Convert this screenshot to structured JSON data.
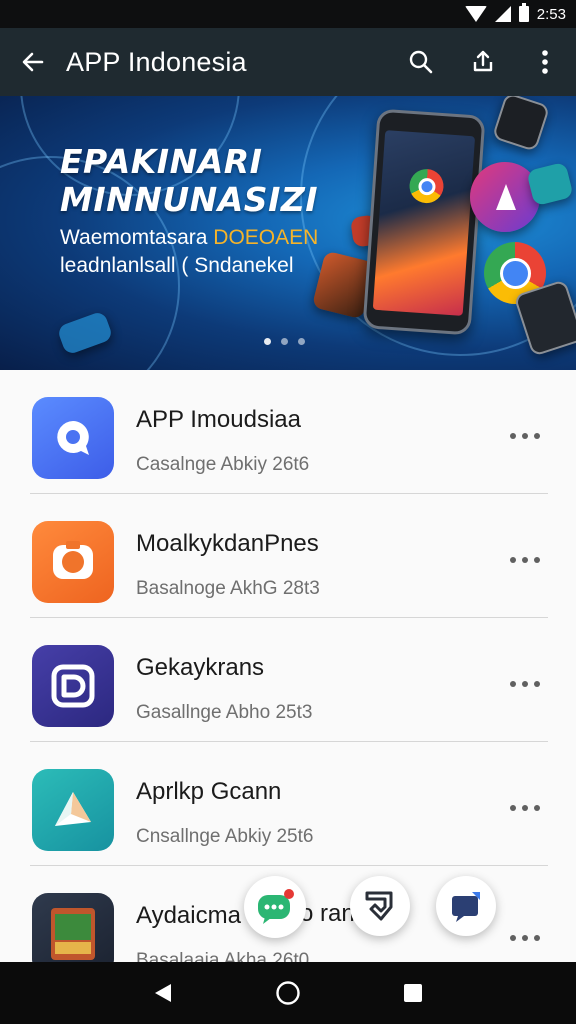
{
  "status_bar": {
    "time": "2:53"
  },
  "app_bar": {
    "title": "APP Indonesia",
    "icons": [
      "back-arrow-icon",
      "search-icon",
      "share-icon",
      "more-vert-icon"
    ]
  },
  "banner": {
    "headline_1": "EPAKINARI",
    "headline_2": "MINNUNASIZI",
    "subtitle_1_left": "Waemomtasara",
    "subtitle_1_right": "DOEOAEN",
    "subtitle_2": "leadnlanlsall ( Sndanekel",
    "page_indicator": {
      "count": 3,
      "active": 0
    }
  },
  "apps": [
    {
      "name": "APP Imoudsiaa",
      "meta": "Casalnge Abkiy   26t6",
      "color": "#3f6ff0",
      "icon": "chat-bubble-app-icon"
    },
    {
      "name": "MoalkykdanPnes",
      "meta": "Basalnoge AkhG   28t3",
      "color": "#f07a2e",
      "icon": "camera-app-icon"
    },
    {
      "name": "Gekaykrans",
      "meta": "Gasallnge Abho   25t3",
      "color": "#3a3596",
      "icon": "d-letter-app-icon"
    },
    {
      "name": "Aprlkp Gcann",
      "meta": "Cnsallnge Abkiy   25t6",
      "color": "#1fa7a8",
      "icon": "paper-plane-app-icon"
    },
    {
      "name": "Aydaicma",
      "meta": "Basalaaia Akha   26t0",
      "color": "#2a3342",
      "icon": "game-card-app-icon"
    }
  ],
  "overlay": {
    "partial_text": "o ran"
  },
  "nav": {
    "icons": [
      "back-triangle-icon",
      "home-circle-icon",
      "recents-square-icon"
    ]
  }
}
